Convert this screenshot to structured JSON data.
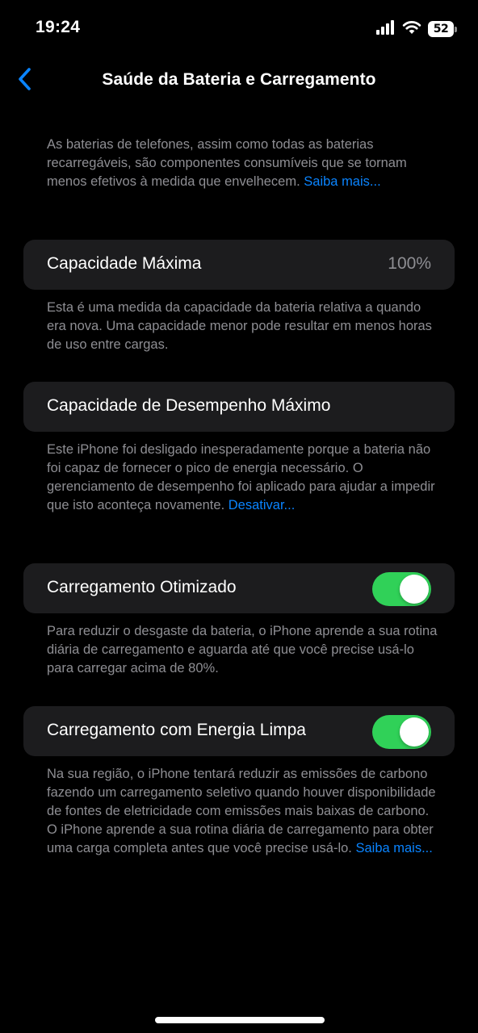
{
  "status_bar": {
    "time": "19:24",
    "battery_level": "52",
    "icons": [
      "cellular-signal-icon",
      "wifi-icon",
      "battery-icon"
    ]
  },
  "nav": {
    "back_icon": "chevron-left-icon",
    "title": "Saúde da Bateria e Carregamento"
  },
  "intro": {
    "text": "As baterias de telefones, assim como todas as baterias recarregáveis, são componentes consumíveis que se tornam menos efetivos à medida que envelhecem.",
    "link": "Saiba mais..."
  },
  "max_capacity": {
    "label": "Capacidade Máxima",
    "value": "100%",
    "footer": "Esta é uma medida da capacidade da bateria relativa a quando era nova. Uma capacidade menor pode resultar em menos horas de uso entre cargas."
  },
  "peak_performance": {
    "label": "Capacidade de Desempenho Máximo",
    "footer": "Este iPhone foi desligado inesperadamente porque a bateria não foi capaz de fornecer o pico de energia necessário. O gerenciamento de desempenho foi aplicado para ajudar a impedir que isto aconteça novamente.",
    "link": "Desativar..."
  },
  "optimized_charging": {
    "label": "Carregamento Otimizado",
    "enabled": true,
    "footer": "Para reduzir o desgaste da bateria, o iPhone aprende a sua rotina diária de carregamento e aguarda até que você precise usá-lo para carregar acima de 80%."
  },
  "clean_energy": {
    "label": "Carregamento com Energia Limpa",
    "enabled": true,
    "footer": "Na sua região, o iPhone tentará reduzir as emissões de carbono fazendo um carregamento seletivo quando houver disponibilidade de fontes de eletricidade com emissões mais baixas de carbono. O iPhone aprende a sua rotina diária de carregamento para obter uma carga completa antes que você precise usá-lo.",
    "link": "Saiba mais..."
  },
  "colors": {
    "background": "#000000",
    "cell": "#1c1c1e",
    "secondary_text": "#8e8e93",
    "link": "#0a84ff",
    "toggle_on": "#30d158"
  }
}
